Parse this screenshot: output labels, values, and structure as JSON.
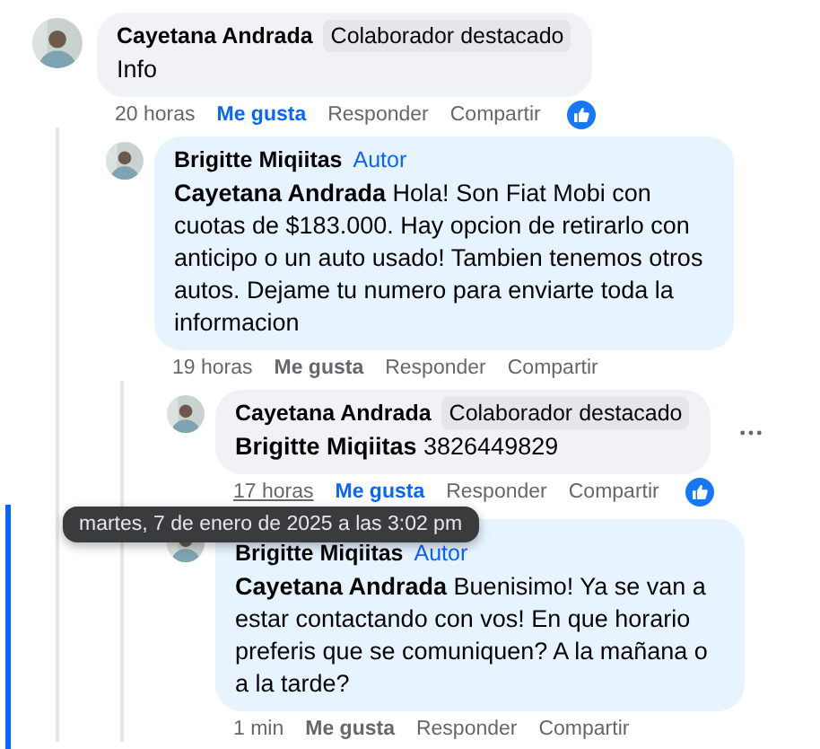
{
  "comments": [
    {
      "author": "Cayetana Andrada",
      "badge": {
        "kind": "featured",
        "text": "Colaborador destacado"
      },
      "text": "Info",
      "time": "20 horas",
      "time_hovered": false,
      "like": "Me gusta",
      "liked": true,
      "reply": "Responder",
      "share": "Compartir",
      "reaction": true,
      "options": false,
      "highlighted": false,
      "children": [
        {
          "author": "Brigitte Miqiitas",
          "badge": {
            "kind": "author",
            "text": "Autor"
          },
          "text": "**Cayetana Andrada** Hola! Son Fiat Mobi con cuotas de $183.000. Hay opcion de retirarlo con anticipo o un auto usado! Tambien tenemos otros autos. Dejame tu numero para enviarte toda la informacion",
          "time": "19 horas",
          "time_hovered": false,
          "like": "Me gusta",
          "liked": false,
          "reply": "Responder",
          "share": "Compartir",
          "reaction": false,
          "options": false,
          "highlighted": false,
          "children": [
            {
              "author": "Cayetana Andrada",
              "badge": {
                "kind": "featured",
                "text": "Colaborador destacado"
              },
              "text": "**Brigitte Miqiitas** 3826449829",
              "time": "17 horas",
              "time_hovered": true,
              "tooltip": "martes, 7 de enero de 2025 a las 3:02 pm",
              "like": "Me gusta",
              "liked": true,
              "reply": "Responder",
              "share": "Compartir",
              "reaction": true,
              "options": true,
              "highlighted": false
            },
            {
              "author": "Brigitte Miqiitas",
              "badge": {
                "kind": "author",
                "text": "Autor"
              },
              "text": "**Cayetana Andrada** Buenisimo! Ya se van a estar contactando con vos! En que horario preferis que se comuniquen? A la mañana o a la tarde?",
              "time": "1 min",
              "time_hovered": false,
              "like": "Me gusta",
              "liked": false,
              "reply": "Responder",
              "share": "Compartir",
              "reaction": false,
              "options": false,
              "highlighted": true
            }
          ]
        }
      ]
    }
  ]
}
